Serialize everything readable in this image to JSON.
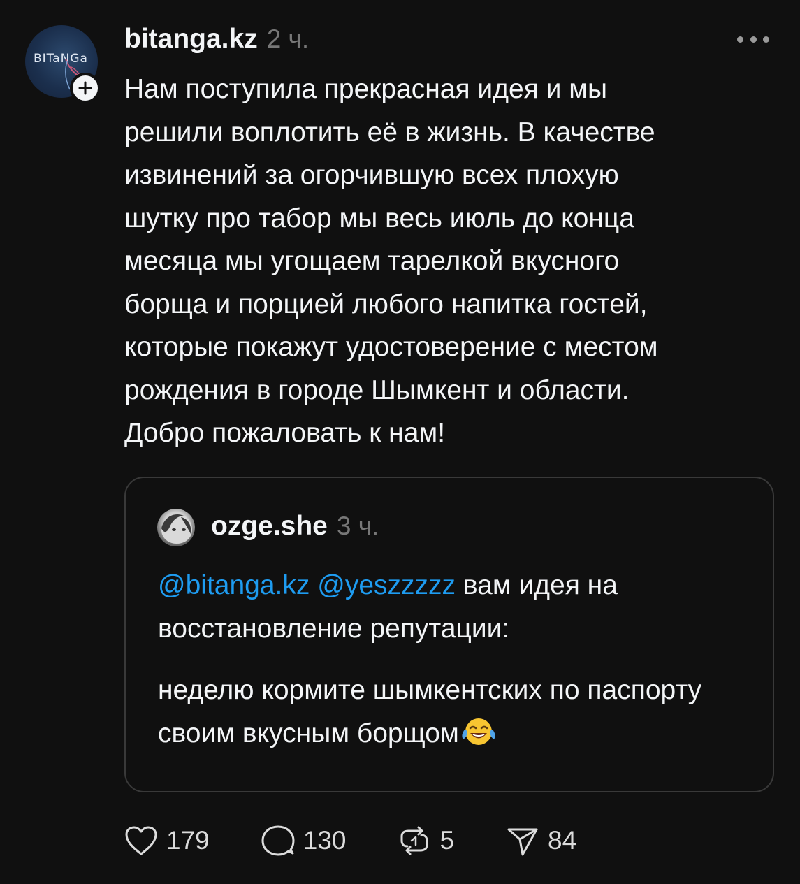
{
  "post": {
    "author": "bitanga.kz",
    "avatar_text": "BITaNGa",
    "time": "2 ч.",
    "text": "Нам поступила прекрасная идея и мы\nрешили воплотить её в жизнь. В качестве\nизвинений за огорчившую всех плохую\nшутку про табор мы весь июль до конца\nмесяца мы угощаем тарелкой вкусного\nборща и порцией любого напитка гостей,\nкоторые покажут удостоверение с местом\nрождения в городе Шымкент и области.\nДобро пожаловать к нам!"
  },
  "quote": {
    "author": "ozge.she",
    "time": "3 ч.",
    "mention1": "@bitanga.kz",
    "mention2": "@yeszzzzz",
    "line1_rest": " вам идея на восстановление репутации:",
    "para2": "неделю кормите шымкентских по паспорту своим вкусным борщом",
    "emoji": "face-with-tears-of-joy"
  },
  "actions": {
    "likes": "179",
    "replies": "130",
    "reposts": "5",
    "shares": "84"
  },
  "colors": {
    "background": "#101010",
    "text": "#f3f5f7",
    "muted": "#777777",
    "mention": "#1e9cf1",
    "border": "#393939"
  }
}
